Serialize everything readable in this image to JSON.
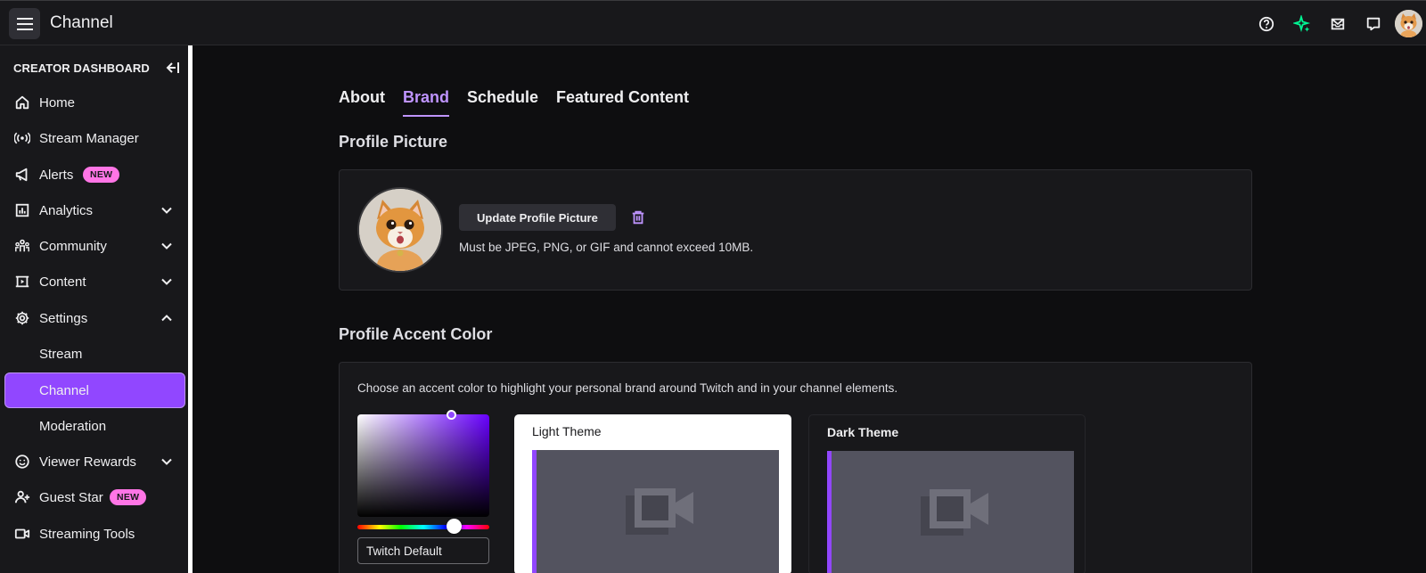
{
  "header": {
    "title": "Channel"
  },
  "sidebar": {
    "header": "CREATOR DASHBOARD",
    "items": [
      {
        "label": "Home"
      },
      {
        "label": "Stream Manager"
      },
      {
        "label": "Alerts",
        "badge": "NEW"
      },
      {
        "label": "Analytics"
      },
      {
        "label": "Community"
      },
      {
        "label": "Content"
      },
      {
        "label": "Settings"
      },
      {
        "label": "Stream"
      },
      {
        "label": "Channel"
      },
      {
        "label": "Moderation"
      },
      {
        "label": "Viewer Rewards"
      },
      {
        "label": "Guest Star",
        "badge": "NEW"
      },
      {
        "label": "Streaming Tools"
      }
    ],
    "active_item": "Channel"
  },
  "tabs": [
    {
      "label": "About"
    },
    {
      "label": "Brand"
    },
    {
      "label": "Schedule"
    },
    {
      "label": "Featured Content"
    }
  ],
  "active_tab": "Brand",
  "profile_picture": {
    "title": "Profile Picture",
    "update_button": "Update Profile Picture",
    "hint": "Must be JPEG, PNG, or GIF and cannot exceed 10MB."
  },
  "accent": {
    "title": "Profile Accent Color",
    "description": "Choose an accent color to highlight your personal brand around Twitch and in your channel elements.",
    "color_value": "Twitch Default",
    "accent_color": "#9147ff",
    "light_theme_label": "Light Theme",
    "dark_theme_label": "Dark Theme"
  },
  "colors": {
    "brand_purple": "#9147ff",
    "light_purple": "#bf94ff",
    "badge_pink": "#ff75e6",
    "background": "#0e0e10",
    "surface": "#18181b"
  },
  "icons": [
    "menu-icon",
    "help-icon",
    "sparkle-icon",
    "inbox-icon",
    "chat-icon",
    "collapse-icon",
    "home-icon",
    "broadcast-icon",
    "megaphone-icon",
    "analytics-icon",
    "community-icon",
    "content-icon",
    "gear-icon",
    "smile-icon",
    "person-add-icon",
    "camera-icon",
    "trash-icon",
    "chevron-down-icon",
    "chevron-up-icon"
  ]
}
